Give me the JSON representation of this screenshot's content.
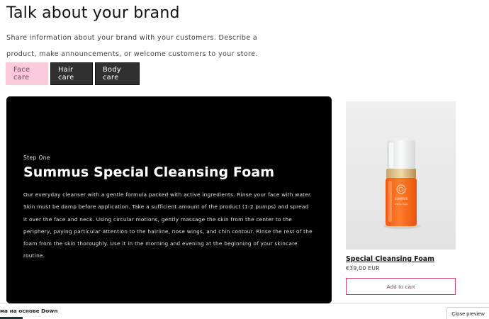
{
  "section": {
    "heading": "Talk about your brand",
    "description": "Share information about your brand with your customers. Describe a product, make announcements, or welcome customers to your store."
  },
  "tabs": [
    {
      "label": "Face care",
      "active": true
    },
    {
      "label": "Hair care",
      "active": false
    },
    {
      "label": "Body care",
      "active": false
    }
  ],
  "panel": {
    "step": "Step One",
    "title": "Summus Special Cleansing Foam",
    "body": "Our everyday cleanser with a gentle formula packed with active ingredients. Rinse your face with water. Skin must be damp before application. Take a sufficient amount of the product (1-2 pumps) and spread it over the face and neck. Using circular motions, gently massage the skin from the center to the periphery, paying particular attention to the hairline, nose wings, and chin contour. Rinse the rest of the foam from the skin thoroughly. Use it in the morning and evening at the beginning of your skincare routine."
  },
  "product": {
    "name": "Special Cleansing Foam",
    "price": "€39,00 EUR",
    "button": "Add to cart",
    "bottle_brand": "SUMMUS",
    "bottle_sub": "SPECIAL FOAM"
  },
  "footer": {
    "theme_label": "ма на основе Down",
    "close_preview": "Close preview"
  },
  "colors": {
    "active_tab": "#fbc8dc",
    "inactive_tab": "#303030",
    "panel_bg": "#000000",
    "button_border": "#cf3d6f",
    "bottle_orange": "#ff6a1a"
  }
}
